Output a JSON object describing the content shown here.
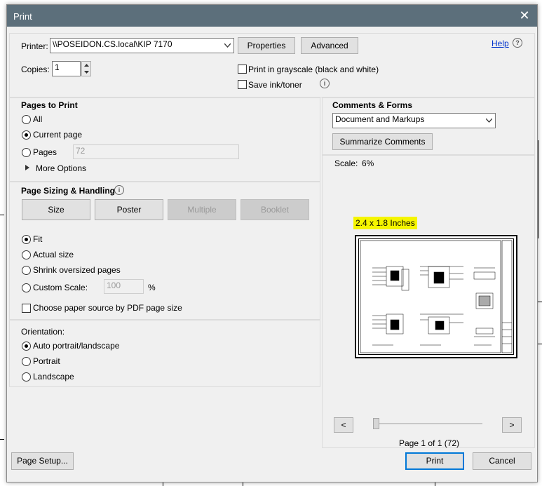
{
  "window": {
    "title": "Print",
    "close_glyph": "✕"
  },
  "printer": {
    "label": "Printer:",
    "value": "\\\\POSEIDON.CS.local\\KIP 7170",
    "properties_label": "Properties",
    "advanced_label": "Advanced",
    "help_label": "Help",
    "copies_label": "Copies:",
    "copies_value": "1",
    "grayscale_label": "Print in grayscale (black and white)",
    "save_ink_label": "Save ink/toner"
  },
  "pages_to_print": {
    "heading": "Pages to Print",
    "all_label": "All",
    "current_label": "Current page",
    "pages_label": "Pages",
    "pages_value": "72",
    "more_options_label": "More Options"
  },
  "sizing": {
    "heading": "Page Sizing & Handling",
    "tabs": {
      "size": "Size",
      "poster": "Poster",
      "multiple": "Multiple",
      "booklet": "Booklet"
    },
    "fit_label": "Fit",
    "actual_label": "Actual size",
    "shrink_label": "Shrink oversized pages",
    "custom_label": "Custom Scale:",
    "custom_value": "100",
    "percent": "%",
    "paper_source_label": "Choose paper source by PDF page size"
  },
  "orientation": {
    "heading": "Orientation:",
    "auto_label": "Auto portrait/landscape",
    "portrait_label": "Portrait",
    "landscape_label": "Landscape"
  },
  "comments": {
    "heading": "Comments & Forms",
    "selected": "Document and Markups",
    "summarize_label": "Summarize Comments"
  },
  "preview": {
    "scale_label": "Scale:",
    "scale_value": "6%",
    "size_label": "2.4 x 1.8 Inches",
    "prev_glyph": "<",
    "next_glyph": ">",
    "page_label": "Page 1 of 1 (72)",
    "highlight_color": "#f5f500"
  },
  "footer": {
    "page_setup_label": "Page Setup...",
    "print_label": "Print",
    "cancel_label": "Cancel"
  }
}
